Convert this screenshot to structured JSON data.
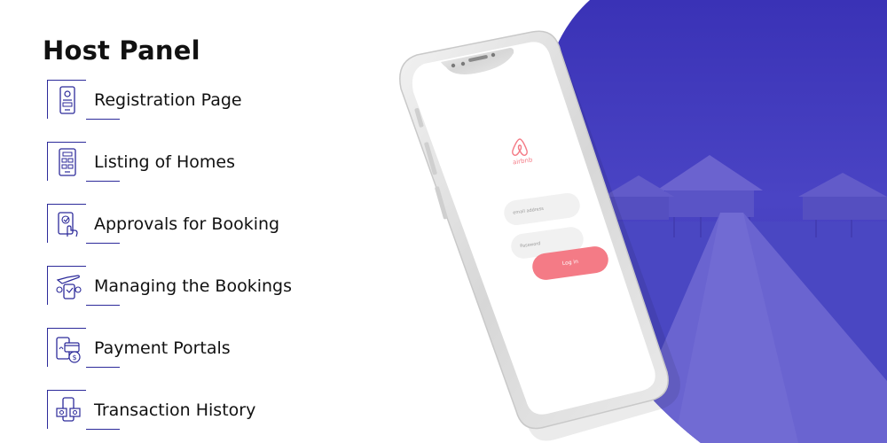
{
  "panel": {
    "title": "Host Panel",
    "items": [
      {
        "label": "Registration Page",
        "icon": "registration-phone-icon"
      },
      {
        "label": "Listing of Homes",
        "icon": "listing-grid-icon"
      },
      {
        "label": "Approvals for Booking",
        "icon": "approval-hand-icon"
      },
      {
        "label": "Managing the Bookings",
        "icon": "managing-plane-icon"
      },
      {
        "label": "Payment Portals",
        "icon": "payment-card-icon"
      },
      {
        "label": "Transaction History",
        "icon": "transaction-money-icon"
      }
    ]
  },
  "phone": {
    "brand": "airbnb",
    "email_placeholder": "email address",
    "password_placeholder": "Password",
    "login_label": "Log in"
  },
  "colors": {
    "accent": "#2c2a9a",
    "hero_blue": "#3b34b8",
    "brand_pink": "#f47b86"
  }
}
